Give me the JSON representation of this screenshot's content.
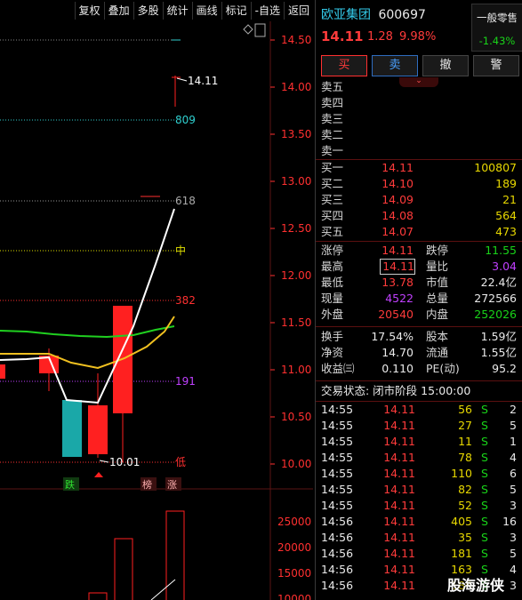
{
  "toolbar": {
    "items": [
      "复权",
      "叠加",
      "多股",
      "统计",
      "画线",
      "标记",
      "-自选",
      "返回"
    ]
  },
  "chart": {
    "price_axis": [
      "14.50",
      "14.00",
      "13.50",
      "13.00",
      "12.50",
      "12.00",
      "11.50",
      "11.00",
      "10.50",
      "10.00"
    ],
    "volume_axis": [
      "25000",
      "20000",
      "15000",
      "10000"
    ],
    "annotations": {
      "high_price": "14.11",
      "low_price": "10.01",
      "fib_809": "809",
      "fib_618": "618",
      "fib_mid": "中",
      "fib_382": "382",
      "fib_191": "191",
      "fib_low": "低"
    },
    "signals": [
      "跌",
      "榜",
      "涨"
    ],
    "colors": {
      "up": "#ff2020",
      "down": "#1aa8a8",
      "ma_white": "#ffffff",
      "ma_yellow": "#f0c020",
      "ma_green": "#20d020"
    }
  },
  "stock": {
    "name": "欧亚集团",
    "code": "600697",
    "price": "14.11",
    "change": "1.28",
    "change_pct": "9.98%",
    "sector": "一般零售",
    "sector_pct": "-1.43%"
  },
  "actions": {
    "buy": "买",
    "sell": "卖",
    "cancel": "撤",
    "alert": "警"
  },
  "asks": [
    {
      "label": "卖五",
      "price": "",
      "vol": ""
    },
    {
      "label": "卖四",
      "price": "",
      "vol": ""
    },
    {
      "label": "卖三",
      "price": "",
      "vol": ""
    },
    {
      "label": "卖二",
      "price": "",
      "vol": ""
    },
    {
      "label": "卖一",
      "price": "",
      "vol": ""
    }
  ],
  "bids": [
    {
      "label": "买一",
      "price": "14.11",
      "vol": "100807"
    },
    {
      "label": "买二",
      "price": "14.10",
      "vol": "189"
    },
    {
      "label": "买三",
      "price": "14.09",
      "vol": "21"
    },
    {
      "label": "买四",
      "price": "14.08",
      "vol": "564"
    },
    {
      "label": "买五",
      "price": "14.07",
      "vol": "473"
    }
  ],
  "stats": {
    "limit_up_label": "涨停",
    "limit_up": "14.11",
    "limit_down_label": "跌停",
    "limit_down": "11.55",
    "high_label": "最高",
    "high": "14.11",
    "vol_ratio_label": "量比",
    "vol_ratio": "3.04",
    "low_label": "最低",
    "low": "13.78",
    "mkt_cap_label": "市值",
    "mkt_cap": "22.4亿",
    "cur_vol_label": "现量",
    "cur_vol": "4522",
    "total_vol_label": "总量",
    "total_vol": "272566",
    "outer_label": "外盘",
    "outer": "20540",
    "inner_label": "内盘",
    "inner": "252026",
    "turnover_label": "换手",
    "turnover": "17.54%",
    "equity_label": "股本",
    "equity": "1.59亿",
    "nav_label": "净资",
    "nav": "14.70",
    "float_label": "流通",
    "float": "1.55亿",
    "eps_label": "收益㈢",
    "eps": "0.110",
    "pe_label": "PE(动)",
    "pe": "95.2"
  },
  "trade_status": "交易状态: 闭市阶段 15:00:00",
  "ticks": [
    {
      "time": "14:55",
      "price": "14.11",
      "vol": "56",
      "side": "S",
      "n": "2"
    },
    {
      "time": "14:55",
      "price": "14.11",
      "vol": "27",
      "side": "S",
      "n": "5"
    },
    {
      "time": "14:55",
      "price": "14.11",
      "vol": "11",
      "side": "S",
      "n": "1"
    },
    {
      "time": "14:55",
      "price": "14.11",
      "vol": "78",
      "side": "S",
      "n": "4"
    },
    {
      "time": "14:55",
      "price": "14.11",
      "vol": "110",
      "side": "S",
      "n": "6"
    },
    {
      "time": "14:55",
      "price": "14.11",
      "vol": "82",
      "side": "S",
      "n": "5"
    },
    {
      "time": "14:55",
      "price": "14.11",
      "vol": "52",
      "side": "S",
      "n": "3"
    },
    {
      "time": "14:56",
      "price": "14.11",
      "vol": "405",
      "side": "S",
      "n": "16"
    },
    {
      "time": "14:56",
      "price": "14.11",
      "vol": "35",
      "side": "S",
      "n": "3"
    },
    {
      "time": "14:56",
      "price": "14.11",
      "vol": "181",
      "side": "S",
      "n": "5"
    },
    {
      "time": "14:56",
      "price": "14.11",
      "vol": "163",
      "side": "S",
      "n": "4"
    },
    {
      "time": "14:56",
      "price": "14.11",
      "vol": "186",
      "side": "S",
      "n": "3"
    }
  ],
  "watermark": "股海游侠"
}
